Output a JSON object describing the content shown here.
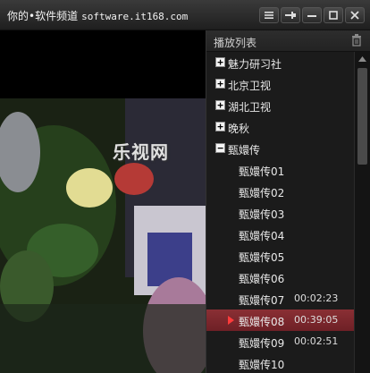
{
  "window": {
    "title": "你的•软件频道",
    "site": "software.it168.com"
  },
  "video": {
    "watermark": "乐视网"
  },
  "playlist": {
    "title": "播放列表",
    "groups": [
      {
        "label": "魅力研习社",
        "expanded": false
      },
      {
        "label": "北京卫视",
        "expanded": false
      },
      {
        "label": "湖北卫视",
        "expanded": false
      },
      {
        "label": "晚秋",
        "expanded": false
      },
      {
        "label": "甄嬛传",
        "expanded": true
      }
    ],
    "episodes": [
      {
        "label": "甄嬛传01",
        "duration": ""
      },
      {
        "label": "甄嬛传02",
        "duration": ""
      },
      {
        "label": "甄嬛传03",
        "duration": ""
      },
      {
        "label": "甄嬛传04",
        "duration": ""
      },
      {
        "label": "甄嬛传05",
        "duration": ""
      },
      {
        "label": "甄嬛传06",
        "duration": ""
      },
      {
        "label": "甄嬛传07",
        "duration": "00:02:23"
      },
      {
        "label": "甄嬛传08",
        "duration": "00:39:05",
        "playing": true
      },
      {
        "label": "甄嬛传09",
        "duration": "00:02:51"
      },
      {
        "label": "甄嬛传10",
        "duration": ""
      }
    ]
  },
  "colors": {
    "selection": "#7c282e",
    "panel_bg": "#1b1b1b",
    "play_marker": "#ff3b3b"
  }
}
